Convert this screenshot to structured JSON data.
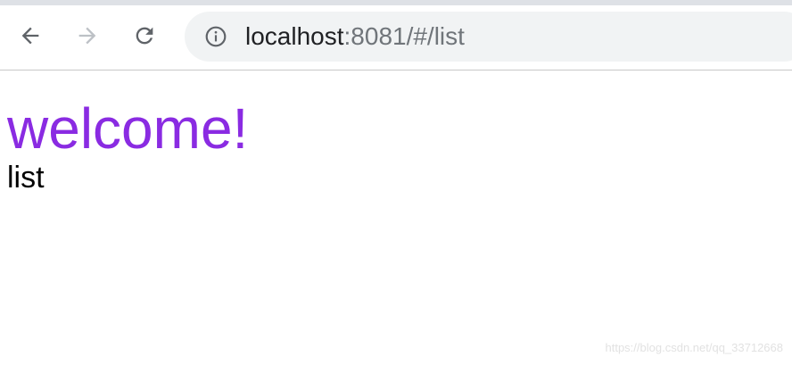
{
  "browser": {
    "url_host": "localhost",
    "url_path": ":8081/#/list",
    "icons": {
      "back": "arrow-left-icon",
      "forward": "arrow-right-icon",
      "reload": "reload-icon",
      "site_info": "info-icon"
    },
    "colors": {
      "strip": "#dee1e6",
      "omnibox": "#f1f3f4",
      "icon": "#5f6368"
    }
  },
  "page": {
    "heading": "welcome!",
    "route_text": "list",
    "heading_color": "#8a2be2"
  },
  "watermark": "https://blog.csdn.net/qq_33712668"
}
